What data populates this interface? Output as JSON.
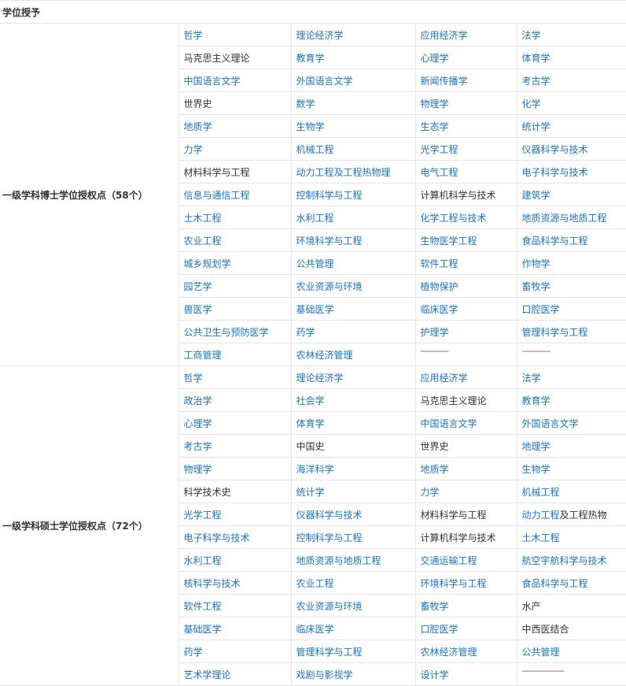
{
  "title": "学位授予",
  "sections": [
    {
      "label": "一级学科博士学位授权点（58个）",
      "rows": [
        [
          {
            "t": "哲学",
            "link": true
          },
          {
            "t": "理论经济学",
            "link": true
          },
          {
            "t": "应用经济学",
            "link": true
          },
          {
            "t": "法学",
            "link": true
          }
        ],
        [
          {
            "t": "马克思主义理论",
            "link": false
          },
          {
            "t": "教育学",
            "link": true
          },
          {
            "t": "心理学",
            "link": true
          },
          {
            "t": "体育学",
            "link": true
          }
        ],
        [
          {
            "t": "中国语言文学",
            "link": true
          },
          {
            "t": "外国语言文学",
            "link": true
          },
          {
            "t": "新闻传播学",
            "link": true
          },
          {
            "t": "考古学",
            "link": true
          }
        ],
        [
          {
            "t": "世界史",
            "link": false
          },
          {
            "t": "数学",
            "link": true
          },
          {
            "t": "物理学",
            "link": true
          },
          {
            "t": "化学",
            "link": true
          }
        ],
        [
          {
            "t": "地质学",
            "link": true
          },
          {
            "t": "生物学",
            "link": true
          },
          {
            "t": "生态学",
            "link": true
          },
          {
            "t": "统计学",
            "link": true
          }
        ],
        [
          {
            "t": "力学",
            "link": true
          },
          {
            "t": "机械工程",
            "link": true
          },
          {
            "t": "光学工程",
            "link": true
          },
          {
            "t": "仪器科学与技术",
            "link": true
          }
        ],
        [
          {
            "t": "材料科学与工程",
            "link": false
          },
          {
            "t": "动力工程及工程热物理",
            "link": true
          },
          {
            "t": "电气工程",
            "link": true
          },
          {
            "t": "电子科学与技术",
            "link": true
          }
        ],
        [
          {
            "t": "信息与通信工程",
            "link": true
          },
          {
            "t": "控制科学与工程",
            "link": true
          },
          {
            "t": "计算机科学与技术",
            "link": false
          },
          {
            "t": "建筑学",
            "link": true
          }
        ],
        [
          {
            "t": "土木工程",
            "link": true
          },
          {
            "t": "水利工程",
            "link": true
          },
          {
            "t": "化学工程与技术",
            "link": true
          },
          {
            "t": "地质资源与地质工程",
            "link": true
          }
        ],
        [
          {
            "t": "农业工程",
            "link": true
          },
          {
            "t": "环境科学与工程",
            "link": true
          },
          {
            "t": "生物医学工程",
            "link": true
          },
          {
            "t": "食品科学与工程",
            "link": true
          }
        ],
        [
          {
            "t": "城乡规划学",
            "link": true
          },
          {
            "t": "公共管理",
            "link": true
          },
          {
            "t": "软件工程",
            "link": true
          },
          {
            "t": "作物学",
            "link": true
          }
        ],
        [
          {
            "t": "园艺学",
            "link": true
          },
          {
            "t": "农业资源与环境",
            "link": true
          },
          {
            "t": "植物保护",
            "link": true
          },
          {
            "t": "畜牧学",
            "link": true
          }
        ],
        [
          {
            "t": "兽医学",
            "link": true
          },
          {
            "t": "基础医学",
            "link": true
          },
          {
            "t": "临床医学",
            "link": true
          },
          {
            "t": "口腔医学",
            "link": true
          }
        ],
        [
          {
            "t": "公共卫生与预防医学",
            "link": true
          },
          {
            "t": "药学",
            "link": true
          },
          {
            "t": "护理学",
            "link": true
          },
          {
            "t": "管理科学与工程",
            "link": true
          }
        ],
        [
          {
            "t": "工商管理",
            "link": true
          },
          {
            "t": "农林经济管理",
            "link": true
          },
          {
            "t": "------------",
            "dash": true
          },
          {
            "t": "------------",
            "dash": true
          }
        ]
      ]
    },
    {
      "label": "一级学科硕士学位授权点（72个）",
      "rows": [
        [
          {
            "t": "哲学",
            "link": true
          },
          {
            "t": "理论经济学",
            "link": true
          },
          {
            "t": "应用经济学",
            "link": true
          },
          {
            "t": "法学",
            "link": true
          }
        ],
        [
          {
            "t": "政治学",
            "link": true
          },
          {
            "t": "社会学",
            "link": true
          },
          {
            "t": "马克思主义理论",
            "link": false
          },
          {
            "t": "教育学",
            "link": true
          }
        ],
        [
          {
            "t": "心理学",
            "link": true
          },
          {
            "t": "体育学",
            "link": true
          },
          {
            "t": "中国语言文学",
            "link": true
          },
          {
            "t": "外国语言文学",
            "link": true
          }
        ],
        [
          {
            "t": "考古学",
            "link": true
          },
          {
            "t": "中国史",
            "link": false
          },
          {
            "t": "世界史",
            "link": false
          },
          {
            "t": "地理学",
            "link": true
          }
        ],
        [
          {
            "t": "物理学",
            "link": true
          },
          {
            "t": "海洋科学",
            "link": true
          },
          {
            "t": "地质学",
            "link": true
          },
          {
            "t": "生物学",
            "link": true
          }
        ],
        [
          {
            "t": "科学技术史",
            "link": false
          },
          {
            "t": "统计学",
            "link": true
          },
          {
            "t": "力学",
            "link": true
          },
          {
            "t": "机械工程",
            "link": true
          }
        ],
        [
          {
            "t": "光学工程",
            "link": true
          },
          {
            "t": "仪器科学与技术",
            "link": true
          },
          {
            "t": "材料科学与工程",
            "link": false
          },
          {
            "t": "动力工程",
            "link": true,
            "suffix": "及工程热物"
          }
        ],
        [
          {
            "t": "电子科学与技术",
            "link": true
          },
          {
            "t": "控制科学与工程",
            "link": true
          },
          {
            "t": "计算机科学与技术",
            "link": false
          },
          {
            "t": "土木工程",
            "link": true
          }
        ],
        [
          {
            "t": "水利工程",
            "link": true
          },
          {
            "t": "地质资源与地质工程",
            "link": true
          },
          {
            "t": "交通运输工程",
            "link": true
          },
          {
            "t": "航空宇航科学与技术",
            "link": true
          }
        ],
        [
          {
            "t": "核科学与技术",
            "link": true
          },
          {
            "t": "农业工程",
            "link": true
          },
          {
            "t": "环境科学与工程",
            "link": true
          },
          {
            "t": "食品科学与工程",
            "link": true
          }
        ],
        [
          {
            "t": "软件工程",
            "link": true
          },
          {
            "t": "农业资源与环境",
            "link": true
          },
          {
            "t": "畜牧学",
            "link": true
          },
          {
            "t": "水产",
            "link": false
          }
        ],
        [
          {
            "t": "基础医学",
            "link": true
          },
          {
            "t": "临床医学",
            "link": true
          },
          {
            "t": "口腔医学",
            "link": true
          },
          {
            "t": "中西医结合",
            "link": false
          }
        ],
        [
          {
            "t": "药学",
            "link": true
          },
          {
            "t": "管理科学与工程",
            "link": true
          },
          {
            "t": "农林经济管理",
            "link": true
          },
          {
            "t": "公共管理",
            "link": true
          }
        ],
        [
          {
            "t": "艺术学理论",
            "link": true
          },
          {
            "t": "戏剧与影视学",
            "link": true
          },
          {
            "t": "设计学",
            "link": true
          },
          {
            "t": "------------------",
            "dash": true
          }
        ]
      ]
    }
  ]
}
